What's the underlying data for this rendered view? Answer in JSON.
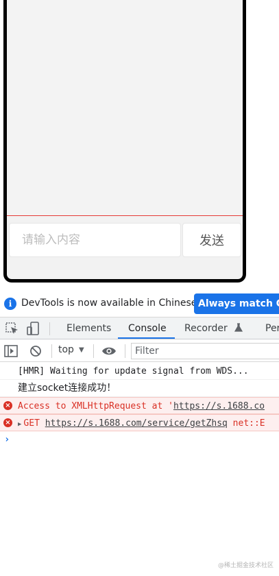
{
  "chat": {
    "input_placeholder": "请输入内容",
    "input_value": "",
    "send_label": "发送"
  },
  "infobar": {
    "message": "DevTools is now available in Chinese!",
    "button_label": "Always match Chr"
  },
  "tabs": [
    {
      "label": "Elements",
      "active": false
    },
    {
      "label": "Console",
      "active": true
    },
    {
      "label": "Recorder",
      "active": false
    },
    {
      "label": "Per",
      "active": false
    }
  ],
  "toolbar": {
    "context": "top",
    "filter_placeholder": "Filter",
    "filter_value": ""
  },
  "console": {
    "logs": [
      {
        "level": "info",
        "text": "[HMR] Waiting for update signal from WDS..."
      },
      {
        "level": "info",
        "text": "建立socket连接成功！"
      },
      {
        "level": "error",
        "prefix": "Access to XMLHttpRequest at '",
        "link": "https://s.1688.co"
      },
      {
        "level": "error",
        "prefix": "GET ",
        "link": "https://s.1688.com/service/getZhsq",
        "suffix": " net::E"
      }
    ]
  },
  "watermark": "@稀土掘金技术社区",
  "colors": {
    "accent": "#1a73e8",
    "error": "#d93025",
    "error_bg": "#fdefef",
    "divider_red": "#e53935"
  }
}
